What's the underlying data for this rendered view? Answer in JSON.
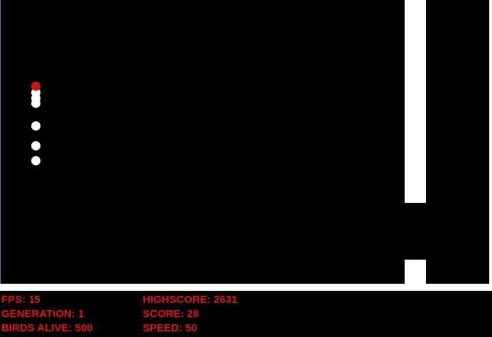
{
  "game": {
    "colors": {
      "background": "#000000",
      "pipe": "#ffffff",
      "bird": "#ffffff",
      "leader_bird": "#c8160f",
      "hud_text": "#e01414"
    },
    "birds": {
      "visible_count": 7,
      "leader_count": 1
    }
  },
  "hud": {
    "fps": "FPS: 15",
    "generation": "GENERATION: 1",
    "birds_alive": "BIRDS ALIVE: 500",
    "highscore": "HIGHSCORE: 2631",
    "score": "SCORE: 28",
    "speed": "SPEED: 50"
  }
}
